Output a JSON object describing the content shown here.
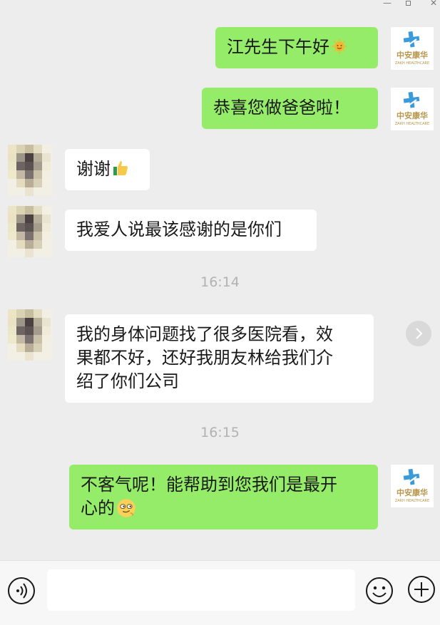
{
  "window": {
    "minimize": "—",
    "close": "✕"
  },
  "contact_avatar": {
    "brand_cn": "中安康华",
    "brand_en": "ZAKH HEALTHCARE"
  },
  "messages": [
    {
      "side": "right",
      "text": "江先生下午好",
      "emoji": "sun-face"
    },
    {
      "side": "right",
      "text": "恭喜您做爸爸啦！"
    },
    {
      "side": "left",
      "text": "谢谢",
      "emoji": "thumbs-up"
    },
    {
      "side": "left",
      "text": "我爱人说最该感谢的是你们"
    },
    {
      "timestamp": "16:14"
    },
    {
      "side": "left",
      "lines": [
        "我的身体问题找了很多医院看，效",
        "果都不好，还好我朋友林给我们介",
        "绍了你们公司"
      ]
    },
    {
      "timestamp": "16:15"
    },
    {
      "side": "right",
      "lines": [
        "不客气呢！能帮助到您我们是最开",
        "心的"
      ],
      "emoji": "smirk-face"
    }
  ],
  "icons": {
    "voice": "voice-icon",
    "emoji": "emoji-icon",
    "plus": "plus-icon",
    "forward": "chevron-right-icon"
  },
  "colors": {
    "background": "#ededed",
    "sent_bubble": "#95ec69",
    "received_bubble": "#ffffff",
    "timestamp": "#b2b2b2",
    "brand_blue": "#3a9bdc",
    "brand_gold": "#b8964b"
  }
}
